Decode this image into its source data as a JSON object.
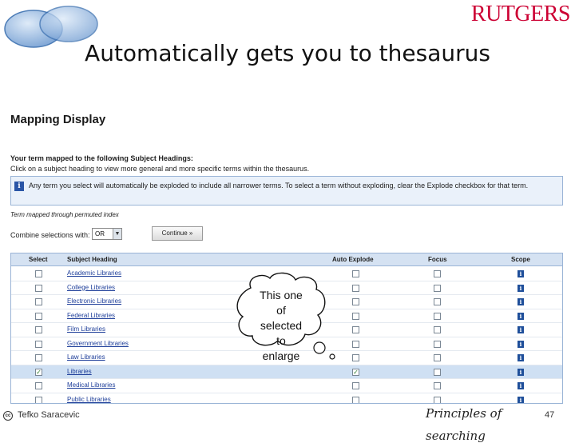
{
  "slide": {
    "brand": "RUTGERS",
    "title": "Automatically gets you to thesaurus",
    "author": "Tefko Saracevic",
    "footer_brand": "Principles of searching",
    "page_number": "47"
  },
  "mapping": {
    "title": "Mapping Display",
    "mapped_heading": "Your term mapped to the following Subject Headings:",
    "mapped_sub": "Click on a subject heading to view more general and more specific terms within the thesaurus.",
    "info_text": "Any term you select will automatically be exploded to include all narrower terms. To select a term without exploding, clear the Explode checkbox for that term.",
    "permuted_note": "Term mapped through permuted index",
    "combine_label": "Combine selections with:",
    "combine_value": "OR",
    "continue_label": "Continue »"
  },
  "table": {
    "columns": {
      "select": "Select",
      "heading": "Subject Heading",
      "explode": "Auto Explode",
      "focus": "Focus",
      "scope": "Scope"
    },
    "rows": [
      {
        "heading": "Academic Libraries",
        "selected": false,
        "explode": false
      },
      {
        "heading": "College Libraries",
        "selected": false,
        "explode": false
      },
      {
        "heading": "Electronic Libraries",
        "selected": false,
        "explode": false
      },
      {
        "heading": "Federal Libraries",
        "selected": false,
        "explode": false
      },
      {
        "heading": "Film Libraries",
        "selected": false,
        "explode": false
      },
      {
        "heading": "Government Libraries",
        "selected": false,
        "explode": false
      },
      {
        "heading": "Law Libraries",
        "selected": false,
        "explode": false
      },
      {
        "heading": "Libraries",
        "selected": true,
        "explode": true
      },
      {
        "heading": "Medical Libraries",
        "selected": false,
        "explode": false
      },
      {
        "heading": "Public Libraries",
        "selected": false,
        "explode": false
      }
    ]
  },
  "callout": {
    "text_lines": [
      "This one",
      "of",
      "selected",
      "to",
      "enlarge"
    ]
  },
  "colors": {
    "brand_red": "#cc0033",
    "link_blue": "#1f3f9a",
    "selected_row": "#cfe0f3"
  }
}
